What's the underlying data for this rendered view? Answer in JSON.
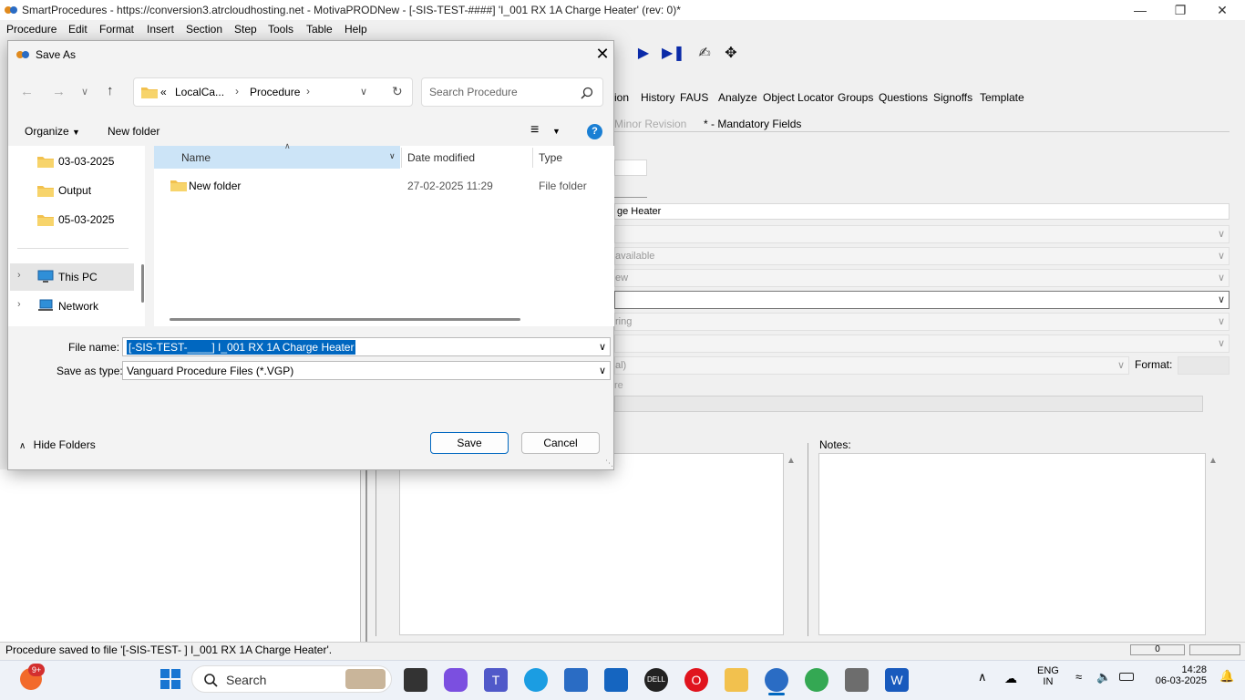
{
  "window": {
    "title": "SmartProcedures - https://conversion3.atrcloudhosting.net - MotivaPRODNew - [-SIS-TEST-####] 'I_001 RX 1A Charge Heater' (rev: 0)*"
  },
  "menu": [
    "Procedure",
    "Edit",
    "Format",
    "Insert",
    "Section",
    "Step",
    "Tools",
    "Table",
    "Help"
  ],
  "tabs": [
    "ion",
    "History",
    "FAUS",
    "Analyze",
    "Object Locator",
    "Groups",
    "Questions",
    "Signoffs",
    "Template"
  ],
  "properties": {
    "minor_revision": "Minor Revision",
    "mandatory_fields": "* - Mandatory Fields",
    "title_value": "ge Heater",
    "combo1": "available",
    "combo2": "ew",
    "combo3": "ring",
    "combo4": "al)",
    "format_label": "Format:",
    "re_label": "re",
    "notes_label": "Notes:"
  },
  "status": {
    "text": "Procedure saved to file '[-SIS-TEST-       ] I_001 RX 1A Charge Heater'.",
    "counter": "0"
  },
  "dialog": {
    "title": "Save As",
    "breadcrumb": {
      "prefix": "«",
      "parts": [
        "LocalCa...",
        "Procedure"
      ]
    },
    "search_placeholder": "Search Procedure",
    "organize": "Organize",
    "new_folder": "New folder",
    "nav_items": [
      {
        "label": "03-03-2025",
        "icon": "folder-icon"
      },
      {
        "label": "Output",
        "icon": "folder-icon"
      },
      {
        "label": "05-03-2025",
        "icon": "folder-icon"
      },
      {
        "label": "This PC",
        "icon": "computer-icon"
      },
      {
        "label": "Network",
        "icon": "network-icon"
      }
    ],
    "columns": [
      "Name",
      "Date modified",
      "Type"
    ],
    "files": [
      {
        "name": "New folder",
        "date": "27-02-2025 11:29",
        "type": "File folder"
      }
    ],
    "file_name_label": "File name:",
    "file_name_value": "[-SIS-TEST-____] I_001 RX 1A Charge Heater",
    "save_type_label": "Save as type:",
    "save_type_value": "Vanguard Procedure Files (*.VGP)",
    "hide_folders": "Hide Folders",
    "save": "Save",
    "cancel": "Cancel"
  },
  "taskbar": {
    "search": "Search",
    "notification_badge": "9+",
    "lang_line1": "ENG",
    "lang_line2": "IN",
    "time": "14:28",
    "date": "06-03-2025"
  }
}
